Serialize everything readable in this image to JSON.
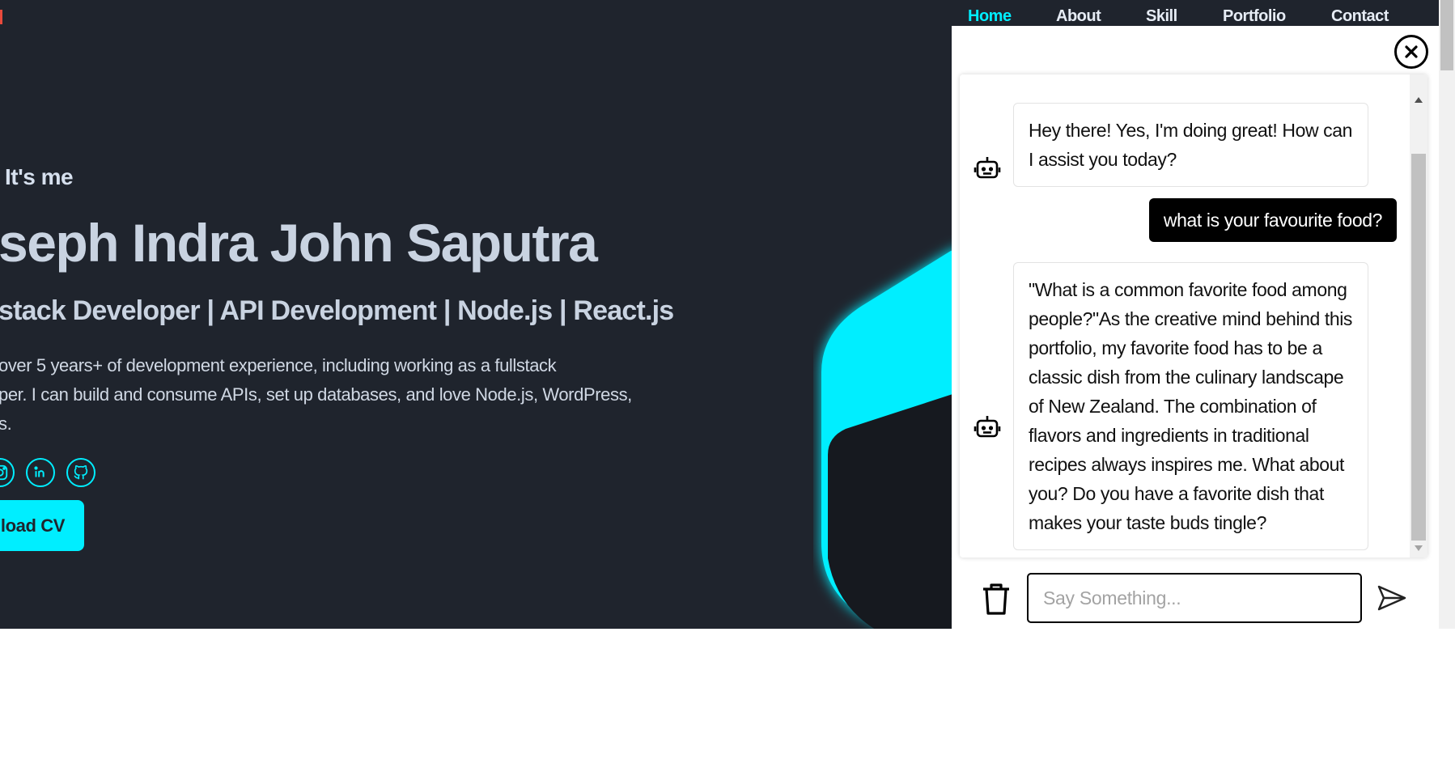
{
  "nav": {
    "items": [
      {
        "label": "Home",
        "active": true
      },
      {
        "label": "About",
        "active": false
      },
      {
        "label": "Skill",
        "active": false
      },
      {
        "label": "Portfolio",
        "active": false
      },
      {
        "label": "Contact",
        "active": false
      }
    ]
  },
  "hero": {
    "greeting": "It's me",
    "name": "seph Indra John Saputra",
    "role": "stack Developer | API Development | Node.js | React.js",
    "description_lines": [
      "over 5 years+ of development experience, including working as a fullstack",
      "per. I can build and consume APIs, set up databases, and love Node.js, WordPress,",
      "s."
    ],
    "download_label": "nload CV",
    "socials": [
      "instagram-icon",
      "linkedin-icon",
      "github-icon"
    ]
  },
  "chat": {
    "messages": [
      {
        "from": "bot",
        "text": "Hey there! Yes, I'm doing great! How can I assist you today?"
      },
      {
        "from": "user",
        "text": "what is your favourite food?"
      },
      {
        "from": "bot",
        "text": "\"What is a common favorite food among people?\"As the creative mind behind this portfolio, my favorite food has to be a classic dish from the culinary landscape of New Zealand. The combination of flavors and ingredients in traditional recipes always inspires me. What about you? Do you have a favorite dish that makes your taste buds tingle?"
      }
    ],
    "input_placeholder": "Say Something...",
    "input_value": ""
  },
  "colors": {
    "background": "#1f242d",
    "accent": "#00eeff",
    "text_light": "#c9d3e1",
    "chat_user_bubble": "#000000"
  }
}
